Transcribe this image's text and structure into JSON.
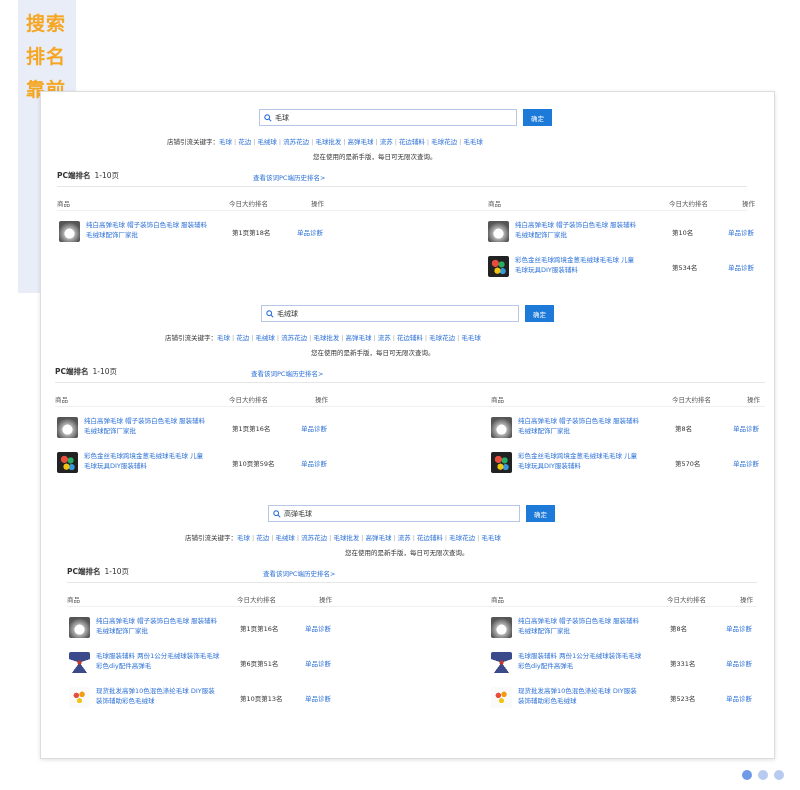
{
  "side_title": [
    "搜索",
    "排名",
    "靠前"
  ],
  "icons": {
    "search": "search-icon"
  },
  "colors": {
    "accent": "#1e7ad8",
    "link": "#2a6fd6",
    "title": "#f5a623"
  },
  "common": {
    "keywords_prefix": "店铺引流关键字：",
    "keywords": [
      "毛球",
      "花边",
      "毛绒球",
      "流苏花边",
      "毛球批发",
      "高弹毛球",
      "流苏",
      "花边辅料",
      "毛球花边",
      "毛毛球"
    ],
    "notice": "您在使用的是新手版，每日可无限次查询。",
    "search_button": "确定",
    "section_title": "PC端排名",
    "section_range": "1-10页",
    "history_link": "查看该词PC端历史排名>",
    "th_product": "商品",
    "th_rank": "今日大约排名",
    "th_action": "操作",
    "diag_label": "单品诊断"
  },
  "blocks": [
    {
      "query": "毛球",
      "left_rows": [
        {
          "name": "纯白高弹毛球 帽子装饰白色毛球 服装辅料毛绒球配饰厂家批",
          "rank": "第1页第18名",
          "thumb": "t1"
        }
      ],
      "right_rows": [
        {
          "name": "纯白高弹毛球 帽子装饰白色毛球 服装辅料毛绒球配饰厂家批",
          "rank": "第10名",
          "thumb": "t1"
        },
        {
          "name": "彩色金丝毛球跨境金葱毛绒球毛毛球 儿童毛球玩具DIY服装辅料",
          "rank": "第534名",
          "thumb": "t2"
        }
      ]
    },
    {
      "query": "毛绒球",
      "left_rows": [
        {
          "name": "纯白高弹毛球 帽子装饰白色毛球 服装辅料毛绒球配饰厂家批",
          "rank": "第1页第16名",
          "thumb": "t1"
        },
        {
          "name": "彩色金丝毛球跨境金葱毛绒球毛毛球 儿童毛球玩具DIY服装辅料",
          "rank": "第10页第59名",
          "thumb": "t2"
        }
      ],
      "right_rows": [
        {
          "name": "纯白高弹毛球 帽子装饰白色毛球 服装辅料毛绒球配饰厂家批",
          "rank": "第8名",
          "thumb": "t1"
        },
        {
          "name": "彩色金丝毛球跨境金葱毛绒球毛毛球 儿童毛球玩具DIY服装辅料",
          "rank": "第570名",
          "thumb": "t2"
        }
      ]
    },
    {
      "query": "高弹毛球",
      "left_rows": [
        {
          "name": "纯白高弹毛球 帽子装饰白色毛球 服装辅料毛绒球配饰厂家批",
          "rank": "第1页第16名",
          "thumb": "t1"
        },
        {
          "name": "毛球服装辅料 两份1公分毛绒球装饰毛毛球 彩色diy配件高弹毛",
          "rank": "第6页第51名",
          "thumb": "t3"
        },
        {
          "name": "现货批发高弹10色混色涤纶毛球 DIY服装装饰辅助彩色毛绒球",
          "rank": "第10页第13名",
          "thumb": "t4"
        }
      ],
      "right_rows": [
        {
          "name": "纯白高弹毛球 帽子装饰白色毛球 服装辅料毛绒球配饰厂家批",
          "rank": "第8名",
          "thumb": "t1"
        },
        {
          "name": "毛球服装辅料 两份1公分毛绒球装饰毛毛球 彩色diy配件高弹毛",
          "rank": "第331名",
          "thumb": "t3"
        },
        {
          "name": "现货批发高弹10色混色涤纶毛球 DIY服装装饰辅助彩色毛绒球",
          "rank": "第523名",
          "thumb": "t4"
        }
      ]
    }
  ],
  "pager": {
    "count": 3,
    "active": 0
  }
}
